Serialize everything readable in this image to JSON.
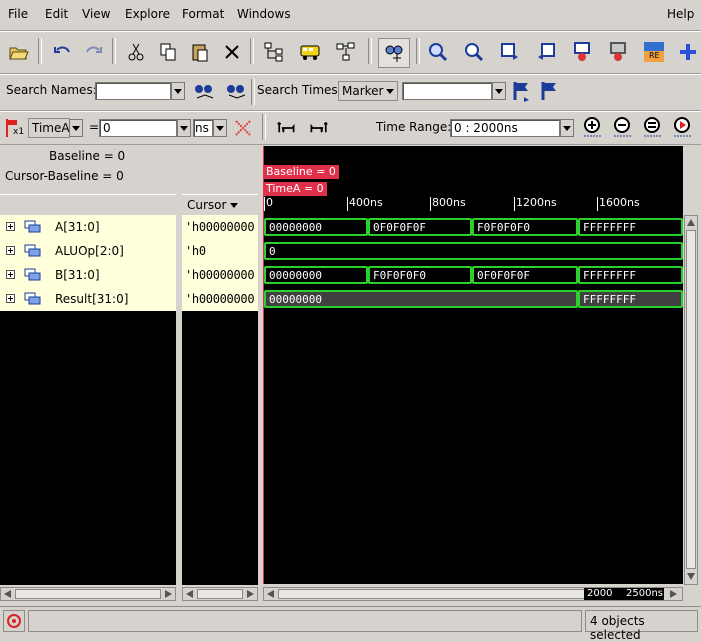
{
  "menu": [
    "File",
    "Edit",
    "View",
    "Explore",
    "Format",
    "Windows",
    "Help"
  ],
  "search": {
    "names_label": "Search Names:",
    "times_label": "Search Times:",
    "times_mode": "Marker"
  },
  "markerbar": {
    "marker": "TimeA",
    "equals": "=",
    "time_value": "0",
    "unit": "ns",
    "range_label": "Time Range:",
    "range_value": "0 : 2000ns",
    "x1": "x1"
  },
  "header": {
    "baseline": "Baseline = 0",
    "cursor_baseline": "Cursor-Baseline = 0",
    "cursor_col": "Cursor"
  },
  "markers": {
    "baseline_tag": "Baseline = 0",
    "timea_tag": "TimeA = 0"
  },
  "timeline": {
    "ticks": [
      "0",
      "400ns",
      "800ns",
      "1200ns",
      "1600ns"
    ],
    "scroll_labels": [
      "2000",
      "2500ns"
    ]
  },
  "signals": [
    {
      "name": "A[31:0]",
      "value": "'h00000000",
      "segments": [
        "00000000",
        "0F0F0F0F",
        "F0F0F0F0",
        "FFFFFFFF"
      ]
    },
    {
      "name": "ALUOp[2:0]",
      "value": "'h0",
      "segments": [
        "0"
      ]
    },
    {
      "name": "B[31:0]",
      "value": "'h00000000",
      "segments": [
        "00000000",
        "F0F0F0F0",
        "0F0F0F0F",
        "FFFFFFFF"
      ]
    },
    {
      "name": "Result[31:0]",
      "value": "'h00000000",
      "segments": [
        "00000000",
        "FFFFFFFF"
      ]
    }
  ],
  "status": {
    "selected": "4 objects selected"
  }
}
